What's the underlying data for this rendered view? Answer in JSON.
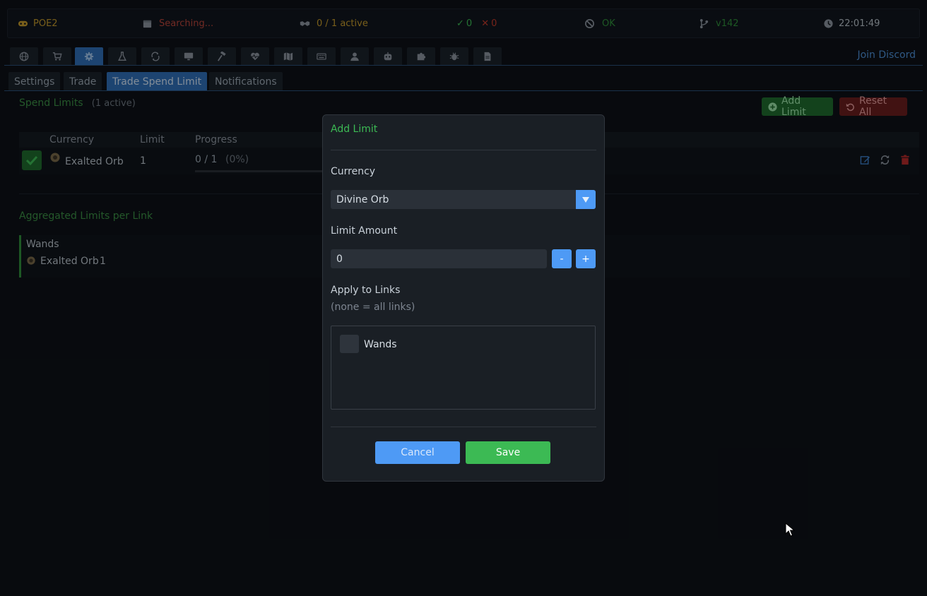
{
  "statusbar": {
    "game": "POE2",
    "search_status": "Searching...",
    "active": "0 / 1 active",
    "success_count": "0",
    "fail_count": "0",
    "status": "OK",
    "version": "v142",
    "clock": "22:01:49"
  },
  "icon_tabs": [
    "globe-icon",
    "cart-icon",
    "gear-icon",
    "flask-icon",
    "arrows-icon",
    "monitor-icon",
    "hammer-icon",
    "heartbeat-icon",
    "map-icon",
    "keyboard-icon",
    "user-icon",
    "robot-icon",
    "puzzle-icon",
    "bug-icon",
    "document-icon"
  ],
  "join_discord": "Join Discord",
  "sub_tabs": [
    "Settings",
    "Trade",
    "Trade Spend Limit",
    "Notifications"
  ],
  "spend_limits": {
    "title": "Spend Limits",
    "count": "(1 active)",
    "add_label": "Add Limit",
    "reset_label": "Reset All",
    "columns": [
      "Currency",
      "Limit",
      "Progress"
    ],
    "row": {
      "currency": "Exalted Orb",
      "limit": "1",
      "progress": "0 / 1",
      "percent": "(0%)",
      "progress_value": 0
    }
  },
  "aggregated": {
    "title": "Aggregated Limits per Link",
    "link_name": "Wands",
    "currency": "Exalted Orb",
    "amount": "1"
  },
  "modal": {
    "title": "Add Limit",
    "currency_label": "Currency",
    "currency_value": "Divine Orb",
    "limit_label": "Limit Amount",
    "limit_value": "0",
    "minus": "-",
    "plus": "+",
    "apply_label": "Apply to Links",
    "apply_hint": "(none = all links)",
    "link_option": "Wands",
    "cancel": "Cancel",
    "save": "Save"
  },
  "colors": {
    "accent_blue": "#4e9af5",
    "green": "#3cba54",
    "red": "#c0392b",
    "bg": "#0d1117"
  }
}
